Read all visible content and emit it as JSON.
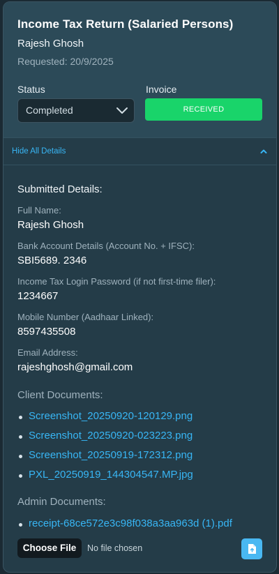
{
  "request": {
    "title": "Income Tax Return (Salaried Persons)",
    "client_name": "Rajesh Ghosh",
    "requested": "Requested: 20/9/2025"
  },
  "status": {
    "label": "Status",
    "value": "Completed"
  },
  "invoice": {
    "label": "Invoice",
    "button": "RECEIVED",
    "color": "#19d46a"
  },
  "toggle": {
    "label": "Hide All Details"
  },
  "details": {
    "heading": "Submitted Details:",
    "fields": [
      {
        "label": "Full Name:",
        "value": "Rajesh Ghosh"
      },
      {
        "label": "Bank Account Details (Account No. + IFSC):",
        "value": "SBI5689. 2346"
      },
      {
        "label": "Income Tax Login Password (if not first-time filer):",
        "value": "1234667"
      },
      {
        "label": "Mobile Number (Aadhaar Linked):",
        "value": "8597435508"
      },
      {
        "label": "Email Address:",
        "value": "rajeshghosh@gmail.com"
      }
    ]
  },
  "client_documents": {
    "heading": "Client Documents:",
    "files": [
      "Screenshot_20250920-120129.png",
      "Screenshot_20250920-023223.png",
      "Screenshot_20250919-172312.png",
      "PXL_20250919_144304547.MP.jpg"
    ]
  },
  "admin_documents": {
    "heading": "Admin Documents:",
    "files": [
      "receipt-68ce572e3c98f038a3aa963d (1).pdf"
    ]
  },
  "upload": {
    "choose_label": "Choose File",
    "no_file_text": "No file chosen",
    "icon": "upload-file-icon"
  },
  "colors": {
    "accent": "#38b6f5",
    "card": "#243c48",
    "header": "#2c4a58"
  }
}
